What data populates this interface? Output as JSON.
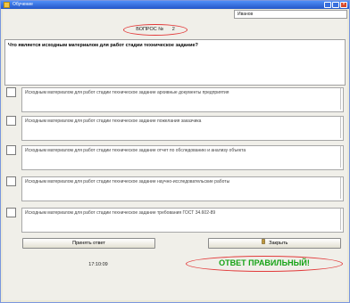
{
  "window": {
    "title": "Обучение",
    "close_glyph": "×"
  },
  "user": {
    "name": "Иванов"
  },
  "question": {
    "label": "ВОПРОС №",
    "number": "2",
    "text": "Что является исходным материалом для работ стадии техническое задание?"
  },
  "answers": [
    {
      "text": "Исходным материалом для работ стадии техническое задание архивные документы предприятия"
    },
    {
      "text": "Исходным материалом для работ стадии техническое задание пожелания заказчика"
    },
    {
      "text": "Исходным материалом для работ стадии техническое задание отчет по обследованию и анализу объекта"
    },
    {
      "text": "Исходным материалом для работ стадии техническое задание научно-исследовательские работы"
    },
    {
      "text": "Исходным материалом для работ стадии техническое задание требования ГОСТ 34.602-89"
    }
  ],
  "buttons": {
    "submit_label": "Принять ответ",
    "close_label": "Закрыть",
    "close_icon": "door-exit-icon"
  },
  "status": {
    "time": "17:10:09",
    "result": "ОТВЕТ ПРАВИЛЬНЫЙ!"
  },
  "colors": {
    "highlight_red": "#e23a3a",
    "result_green": "#16a316"
  }
}
